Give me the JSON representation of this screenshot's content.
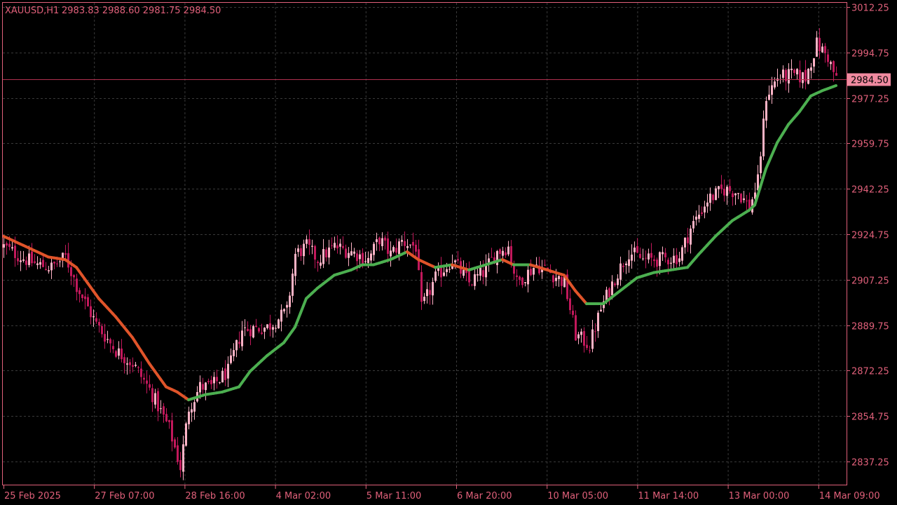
{
  "header": {
    "symbol": "XAUUSD,H1",
    "ohlc": "2983.83 2988.60 2981.75 2984.50"
  },
  "current_price_label": "2984.50",
  "colors": {
    "background": "#000000",
    "axis": "#e0607a",
    "grid": "#3a3a3a",
    "candle": "#c2185b",
    "candle_up": "#ffb3c6",
    "ma_down": "#e0542a",
    "ma_up": "#4caf50",
    "price_line": "#b03050",
    "price_tag_bg": "#f08aa0"
  },
  "chart_data": {
    "type": "candlestick",
    "symbol": "XAUUSD",
    "timeframe": "H1",
    "ylim": [
      2828,
      3016
    ],
    "y_ticks": [
      3012.25,
      2994.75,
      2977.25,
      2959.75,
      2942.25,
      2924.75,
      2907.25,
      2889.75,
      2872.25,
      2854.75,
      2837.25
    ],
    "y_tick_labels": [
      "3012.25",
      "2994.75",
      "2977.25",
      "2959.75",
      "2942.25",
      "2924.75",
      "2907.25",
      "2889.75",
      "2872.25",
      "2854.75",
      "2837.25"
    ],
    "x_ticks": [
      "25 Feb 2025",
      "27 Feb 07:00",
      "28 Feb 16:00",
      "4 Mar 02:00",
      "5 Mar 11:00",
      "6 Mar 20:00",
      "10 Mar 05:00",
      "11 Mar 14:00",
      "13 Mar 00:00",
      "14 Mar 09:00"
    ],
    "current_price": 2984.5,
    "grid": true,
    "close_anchors": [
      [
        0,
        2920
      ],
      [
        6,
        2916
      ],
      [
        12,
        2913
      ],
      [
        17,
        2912
      ],
      [
        22,
        2916
      ],
      [
        26,
        2905
      ],
      [
        33,
        2890
      ],
      [
        40,
        2880
      ],
      [
        46,
        2875
      ],
      [
        52,
        2865
      ],
      [
        59,
        2850
      ],
      [
        63,
        2835
      ],
      [
        66,
        2858
      ],
      [
        70,
        2866
      ],
      [
        74,
        2866
      ],
      [
        80,
        2872
      ],
      [
        85,
        2888
      ],
      [
        94,
        2889
      ],
      [
        101,
        2895
      ],
      [
        104,
        2917
      ],
      [
        108,
        2920
      ],
      [
        112,
        2915
      ],
      [
        118,
        2920
      ],
      [
        124,
        2918
      ],
      [
        130,
        2915
      ],
      [
        134,
        2923
      ],
      [
        138,
        2917
      ],
      [
        142,
        2922
      ],
      [
        147,
        2920
      ],
      [
        149,
        2896
      ],
      [
        154,
        2908
      ],
      [
        160,
        2915
      ],
      [
        166,
        2906
      ],
      [
        171,
        2910
      ],
      [
        176,
        2918
      ],
      [
        180,
        2920
      ],
      [
        183,
        2906
      ],
      [
        190,
        2913
      ],
      [
        195,
        2910
      ],
      [
        200,
        2906
      ],
      [
        204,
        2886
      ],
      [
        209,
        2882
      ],
      [
        213,
        2896
      ],
      [
        218,
        2908
      ],
      [
        223,
        2918
      ],
      [
        228,
        2915
      ],
      [
        233,
        2915
      ],
      [
        241,
        2916
      ],
      [
        245,
        2927
      ],
      [
        251,
        2938
      ],
      [
        257,
        2942
      ],
      [
        262,
        2941
      ],
      [
        266,
        2935
      ],
      [
        269,
        2945
      ],
      [
        272,
        2978
      ],
      [
        276,
        2985
      ],
      [
        281,
        2986
      ],
      [
        286,
        2985
      ],
      [
        290,
        2998
      ],
      [
        294,
        2993
      ],
      [
        297,
        2984
      ]
    ],
    "ma_series": {
      "name": "",
      "anchors": [
        [
          0,
          2924
        ],
        [
          10,
          2919
        ],
        [
          16,
          2916
        ],
        [
          22,
          2915
        ],
        [
          26,
          2912
        ],
        [
          34,
          2900
        ],
        [
          40,
          2893
        ],
        [
          46,
          2885
        ],
        [
          52,
          2875
        ],
        [
          58,
          2866
        ],
        [
          62,
          2864
        ],
        [
          66,
          2861
        ],
        [
          72,
          2863
        ],
        [
          78,
          2864
        ],
        [
          84,
          2866
        ],
        [
          88,
          2872
        ],
        [
          94,
          2878
        ],
        [
          100,
          2883
        ],
        [
          104,
          2889
        ],
        [
          108,
          2900
        ],
        [
          112,
          2904
        ],
        [
          118,
          2909
        ],
        [
          124,
          2911
        ],
        [
          128,
          2913
        ],
        [
          132,
          2913
        ],
        [
          138,
          2915
        ],
        [
          144,
          2918
        ],
        [
          148,
          2915
        ],
        [
          154,
          2912
        ],
        [
          160,
          2913
        ],
        [
          166,
          2911
        ],
        [
          172,
          2913
        ],
        [
          178,
          2915
        ],
        [
          182,
          2913
        ],
        [
          188,
          2913
        ],
        [
          194,
          2911
        ],
        [
          200,
          2909
        ],
        [
          204,
          2903
        ],
        [
          208,
          2898
        ],
        [
          214,
          2898
        ],
        [
          220,
          2903
        ],
        [
          226,
          2908
        ],
        [
          232,
          2910
        ],
        [
          238,
          2911
        ],
        [
          244,
          2912
        ],
        [
          248,
          2917
        ],
        [
          254,
          2924
        ],
        [
          260,
          2930
        ],
        [
          266,
          2934
        ],
        [
          268,
          2936
        ],
        [
          272,
          2950
        ],
        [
          276,
          2960
        ],
        [
          280,
          2967
        ],
        [
          284,
          2972
        ],
        [
          288,
          2978
        ],
        [
          292,
          2980
        ],
        [
          297,
          2982
        ]
      ]
    }
  }
}
